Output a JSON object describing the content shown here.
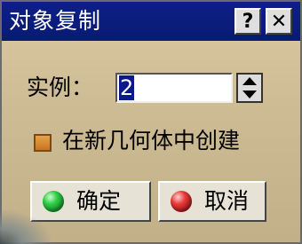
{
  "window": {
    "title": "对象复制",
    "help_label": "?",
    "close_label": "✕"
  },
  "form": {
    "instances_label": "实例：",
    "instances_value": "2",
    "checkbox_label": "在新几何体中创建",
    "checkbox_checked": true
  },
  "buttons": {
    "ok_label": "确定",
    "cancel_label": "取消"
  },
  "colors": {
    "title_bar": "#0c1f86",
    "ok_indicator": "#2ecc45",
    "cancel_indicator": "#e83a3a"
  }
}
